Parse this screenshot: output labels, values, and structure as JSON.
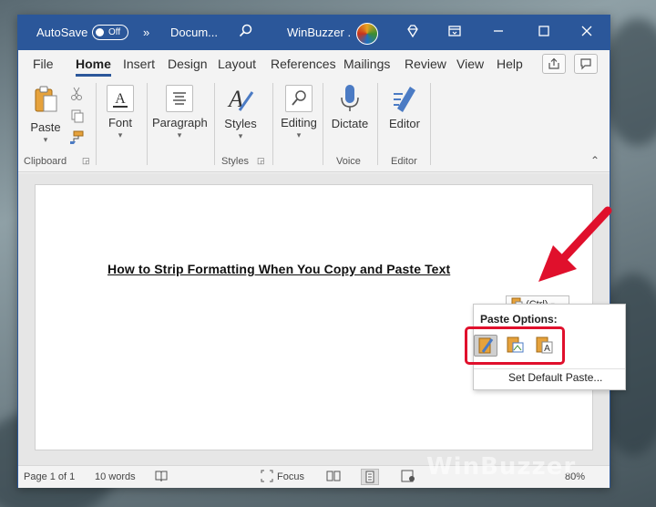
{
  "titlebar": {
    "autosave_label": "AutoSave",
    "autosave_state": "Off",
    "more_glyph": "»",
    "doc_name": "Docum...",
    "account_name": "WinBuzzer .",
    "accent_color": "#2b579a"
  },
  "tabs": [
    "File",
    "Home",
    "Insert",
    "Design",
    "Layout",
    "References",
    "Mailings",
    "Review",
    "View",
    "Help"
  ],
  "active_tab": "Home",
  "ribbon": {
    "clipboard": {
      "paste_label": "Paste",
      "group_label": "Clipboard"
    },
    "font": {
      "label": "Font"
    },
    "paragraph": {
      "label": "Paragraph"
    },
    "styles": {
      "label": "Styles",
      "group_label": "Styles"
    },
    "editing": {
      "label": "Editing"
    },
    "voice": {
      "label": "Dictate",
      "group_label": "Voice"
    },
    "editor": {
      "label": "Editor",
      "group_label": "Editor"
    }
  },
  "document": {
    "heading": "How to Strip Formatting When You Copy and Paste Text",
    "ctrl_label": "(Ctrl)"
  },
  "paste_popup": {
    "title": "Paste Options:",
    "options": [
      "keep-source-formatting-icon",
      "merge-formatting-icon",
      "keep-text-only-icon"
    ],
    "selected_index": 0,
    "set_default": "Set Default Paste..."
  },
  "statusbar": {
    "page": "Page 1 of 1",
    "words": "10 words",
    "focus": "Focus",
    "zoom": "80%"
  },
  "watermark": "WinBuzzer",
  "highlight_color": "#e0102c"
}
